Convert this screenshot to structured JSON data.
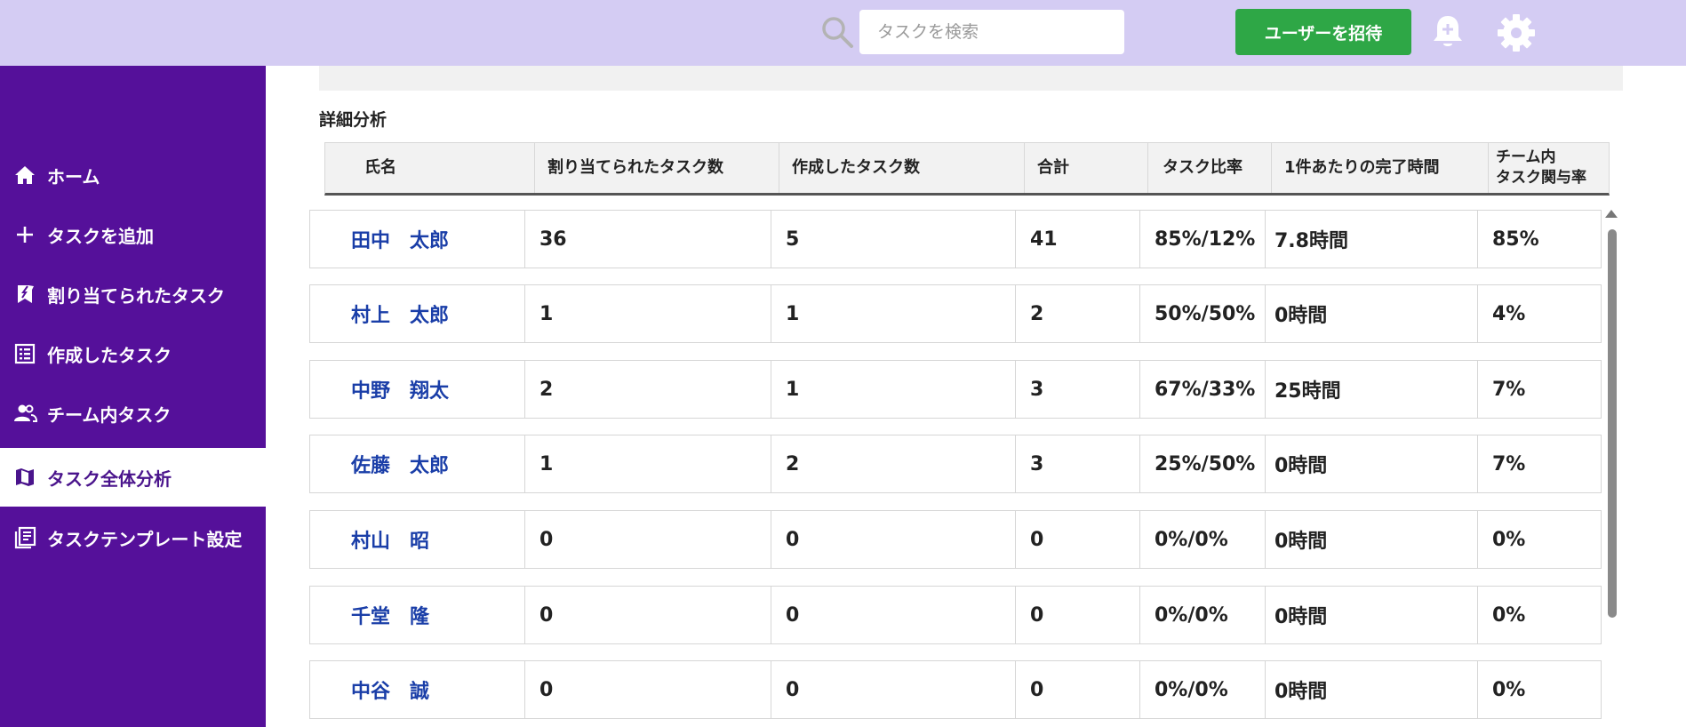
{
  "topbar": {
    "search_placeholder": "タスクを検索",
    "invite_label": "ユーザーを招待",
    "bg_color": "#d4ccf3",
    "accent_green": "#2ea746"
  },
  "sidebar": {
    "bg_color": "#55109a",
    "items": [
      {
        "label": "ホーム",
        "icon": "home-icon",
        "active": false
      },
      {
        "label": "タスクを追加",
        "icon": "plus-icon",
        "active": false
      },
      {
        "label": "割り当てられたタスク",
        "icon": "assigned-flag-icon",
        "active": false
      },
      {
        "label": "作成したタスク",
        "icon": "list-icon",
        "active": false
      },
      {
        "label": "チーム内タスク",
        "icon": "people-icon",
        "active": false
      },
      {
        "label": "タスク全体分析",
        "icon": "map-icon",
        "active": true
      },
      {
        "label": "タスクテンプレート設定",
        "icon": "template-icon",
        "active": false
      }
    ]
  },
  "main": {
    "section_title": "詳細分析",
    "columns": [
      "氏名",
      "割り当てられたタスク数",
      "作成したタスク数",
      "合計",
      "タスク比率",
      "1件あたりの完了時間",
      "チーム内\nタスク関与率"
    ],
    "rows": [
      {
        "name": "田中　太郎",
        "assigned": "36",
        "created": "5",
        "total": "41",
        "ratio": "85%/12%",
        "time": "7.8時間",
        "involvement": "85%"
      },
      {
        "name": "村上　太郎",
        "assigned": "1",
        "created": "1",
        "total": "2",
        "ratio": "50%/50%",
        "time": "0時間",
        "involvement": "4%"
      },
      {
        "name": "中野　翔太",
        "assigned": "2",
        "created": "1",
        "total": "3",
        "ratio": "67%/33%",
        "time": "25時間",
        "involvement": "7%"
      },
      {
        "name": "佐藤　太郎",
        "assigned": "1",
        "created": "2",
        "total": "3",
        "ratio": "25%/50%",
        "time": "0時間",
        "involvement": "7%"
      },
      {
        "name": "村山　昭",
        "assigned": "0",
        "created": "0",
        "total": "0",
        "ratio": "0%/0%",
        "time": "0時間",
        "involvement": "0%"
      },
      {
        "name": "千堂　隆",
        "assigned": "0",
        "created": "0",
        "total": "0",
        "ratio": "0%/0%",
        "time": "0時間",
        "involvement": "0%"
      },
      {
        "name": "中谷　誠",
        "assigned": "0",
        "created": "0",
        "total": "0",
        "ratio": "0%/0%",
        "time": "0時間",
        "involvement": "0%"
      }
    ]
  }
}
